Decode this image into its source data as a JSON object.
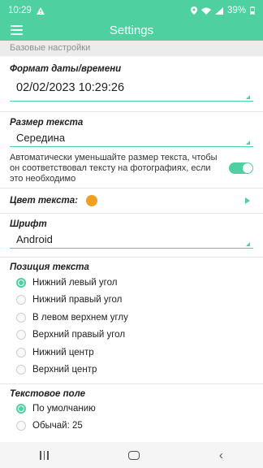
{
  "status_bar": {
    "time": "10:29",
    "alert_icon": "alert-triangle-icon",
    "battery": "39%",
    "accent": "#4fd0a0"
  },
  "app_bar": {
    "title": "Settings",
    "menu_icon": "hamburger-menu-icon"
  },
  "basic_section": {
    "header": "Базовые настройки"
  },
  "date_format": {
    "label": "Формат даты/времени",
    "value": "02/02/2023 10:29:26"
  },
  "text_size": {
    "label": "Размер текста",
    "value": "Середина",
    "auto_shrink_text": "Автоматически уменьшайте размер текста, чтобы он соответствовал тексту на фотографиях, если это необходимо",
    "auto_shrink_enabled": true
  },
  "text_color": {
    "label": "Цвет текста:",
    "swatch": "#f0a020"
  },
  "font": {
    "label": "Шрифт",
    "value": "Android"
  },
  "text_position": {
    "label": "Позиция текста",
    "options": [
      "Нижний левый угол",
      "Нижний правый угол",
      "В левом верхнем углу",
      "Верхний правый угол",
      "Нижний центр",
      "Верхний центр"
    ],
    "selected": "Нижний левый угол"
  },
  "text_field": {
    "label": "Текстовое поле",
    "options": [
      "По умолчанию",
      "Обычай: 25"
    ],
    "selected": "По умолчанию"
  }
}
